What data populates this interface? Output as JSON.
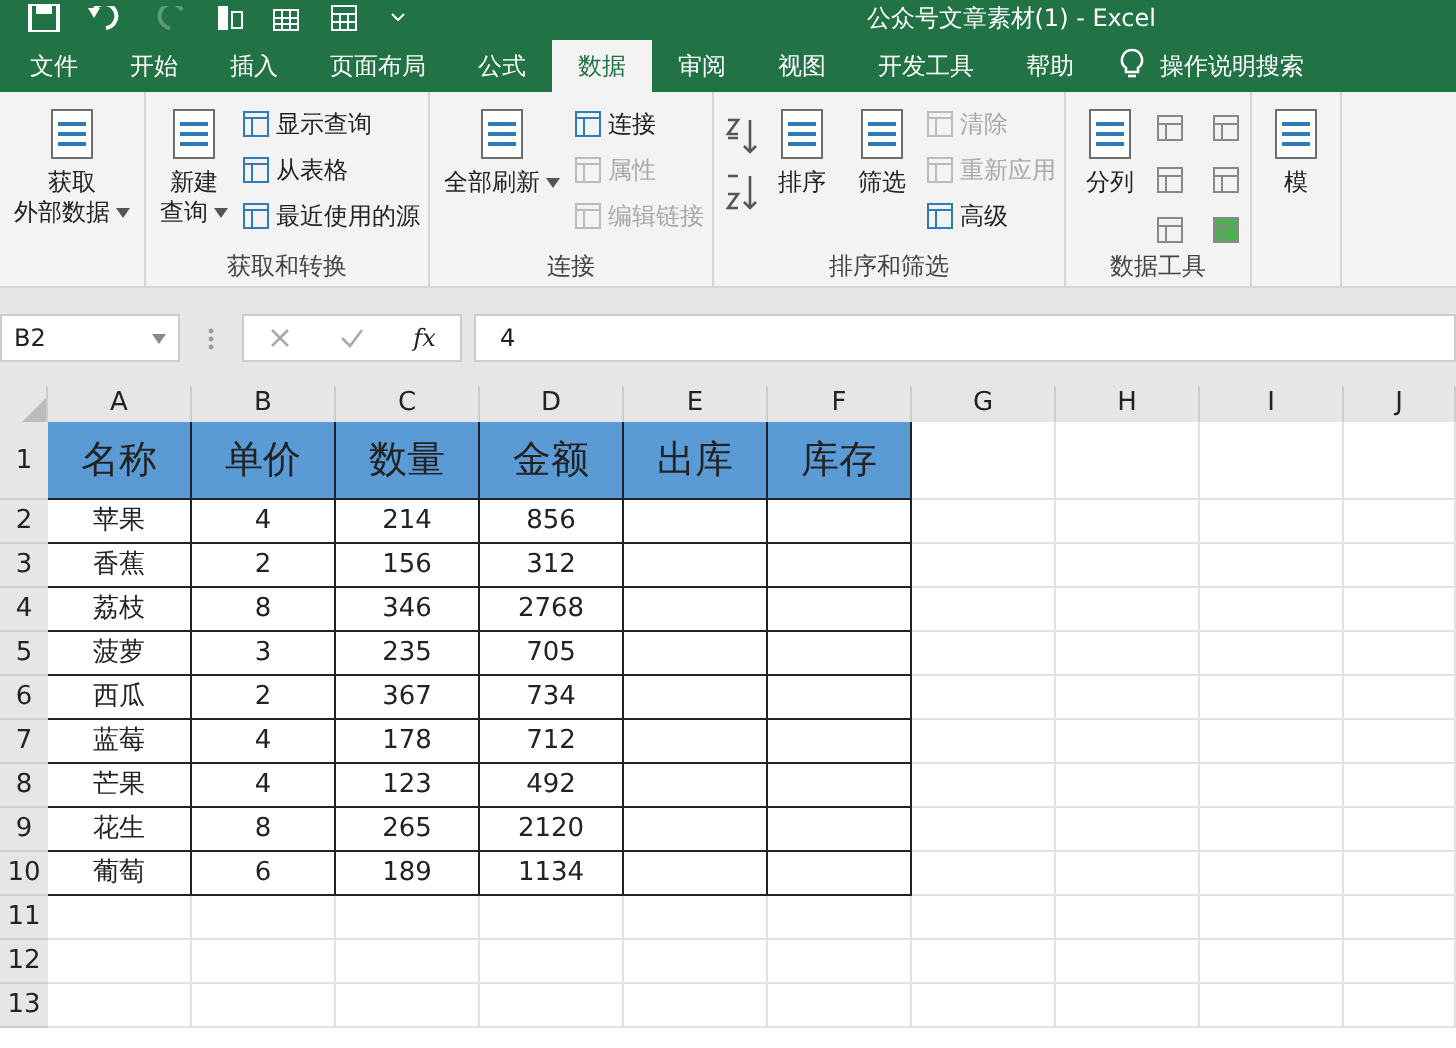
{
  "window": {
    "title": "公众号文章素材(1)  -  Excel"
  },
  "tabs": [
    {
      "label": "文件",
      "selected": false
    },
    {
      "label": "开始",
      "selected": false
    },
    {
      "label": "插入",
      "selected": false
    },
    {
      "label": "页面布局",
      "selected": false
    },
    {
      "label": "公式",
      "selected": false
    },
    {
      "label": "数据",
      "selected": true
    },
    {
      "label": "审阅",
      "selected": false
    },
    {
      "label": "视图",
      "selected": false
    },
    {
      "label": "开发工具",
      "selected": false
    },
    {
      "label": "帮助",
      "selected": false
    }
  ],
  "tell_me": {
    "label": "操作说明搜索"
  },
  "ribbon": {
    "groups": [
      {
        "items": [
          {
            "kind": "large",
            "lines": [
              "获取",
              "外部数据"
            ],
            "dropdown": true,
            "disabled": false
          }
        ]
      },
      {
        "label": "获取和转换",
        "items": [
          {
            "kind": "large",
            "lines": [
              "新建",
              "查询"
            ],
            "dropdown": true,
            "disabled": false
          },
          {
            "kind": "small",
            "label": "显示查询",
            "disabled": false
          },
          {
            "kind": "small",
            "label": "从表格",
            "disabled": false
          },
          {
            "kind": "small",
            "label": "最近使用的源",
            "disabled": false
          }
        ]
      },
      {
        "label": "连接",
        "items": [
          {
            "kind": "large",
            "lines": [
              "全部刷新"
            ],
            "dropdown": true,
            "disabled": false
          },
          {
            "kind": "small",
            "label": "连接",
            "disabled": false
          },
          {
            "kind": "small",
            "label": "属性",
            "disabled": true
          },
          {
            "kind": "small",
            "label": "编辑链接",
            "disabled": true
          }
        ]
      },
      {
        "label": "排序和筛选",
        "items": [
          {
            "kind": "sorticons"
          },
          {
            "kind": "large",
            "lines": [
              "排序"
            ],
            "dropdown": false,
            "disabled": false
          },
          {
            "kind": "large",
            "lines": [
              "筛选"
            ],
            "dropdown": false,
            "disabled": false
          },
          {
            "kind": "small",
            "label": "清除",
            "disabled": true
          },
          {
            "kind": "small",
            "label": "重新应用",
            "disabled": true
          },
          {
            "kind": "small",
            "label": "高级",
            "disabled": false
          }
        ]
      },
      {
        "label": "数据工具",
        "items": [
          {
            "kind": "large",
            "lines": [
              "分列"
            ],
            "dropdown": false,
            "disabled": false
          },
          {
            "kind": "icongrid"
          }
        ]
      },
      {
        "items": [
          {
            "kind": "large",
            "lines": [
              "模"
            ],
            "dropdown": false,
            "disabled": false
          }
        ]
      }
    ]
  },
  "formula_bar": {
    "name_box": "B2",
    "function_label": "fx",
    "formula": "4"
  },
  "sheet": {
    "columns": [
      "A",
      "B",
      "C",
      "D",
      "E",
      "F",
      "G",
      "H",
      "I",
      "J"
    ],
    "rows": [
      "1",
      "2",
      "3",
      "4",
      "5",
      "6",
      "7",
      "8",
      "9",
      "10",
      "11",
      "12",
      "13"
    ],
    "table_header": [
      "名称",
      "单价",
      "数量",
      "金额",
      "出库",
      "库存"
    ],
    "table_rows": [
      [
        "苹果",
        "4",
        "214",
        "856"
      ],
      [
        "香蕉",
        "2",
        "156",
        "312"
      ],
      [
        "荔枝",
        "8",
        "346",
        "2768"
      ],
      [
        "菠萝",
        "3",
        "235",
        "705"
      ],
      [
        "西瓜",
        "2",
        "367",
        "734"
      ],
      [
        "蓝莓",
        "4",
        "178",
        "712"
      ],
      [
        "芒果",
        "4",
        "123",
        "492"
      ],
      [
        "花生",
        "8",
        "265",
        "2120"
      ],
      [
        "葡萄",
        "6",
        "189",
        "1134"
      ]
    ]
  }
}
